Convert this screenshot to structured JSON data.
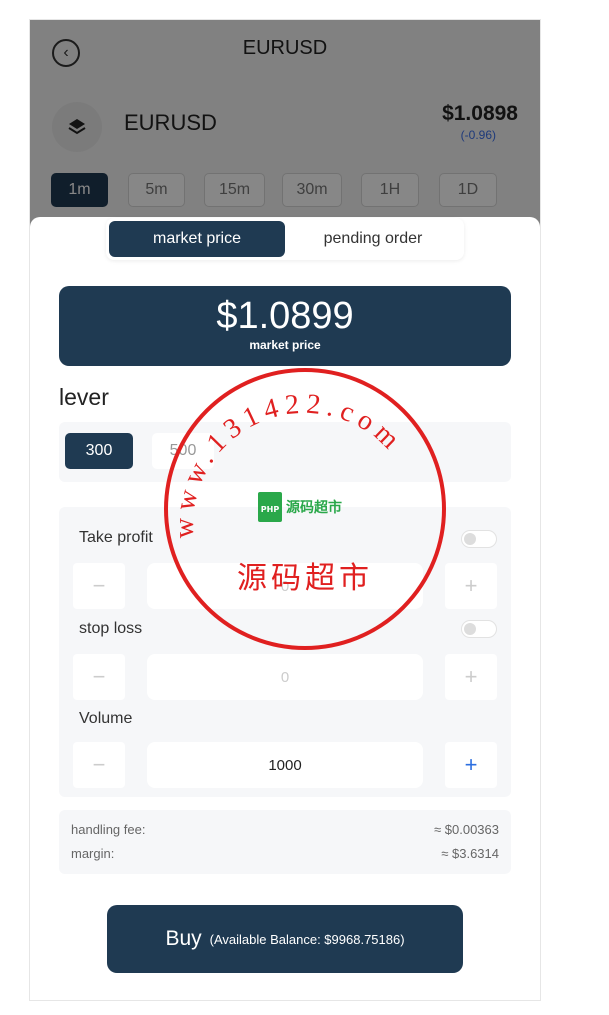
{
  "header": {
    "title": "EURUSD"
  },
  "symbol": {
    "name": "EURUSD",
    "price": "$1.0898",
    "change": "(-0.96)"
  },
  "timeframes": [
    "1m",
    "5m",
    "15m",
    "30m",
    "1H",
    "1D"
  ],
  "order_tabs": {
    "market": "market price",
    "pending": "pending order"
  },
  "price_display": {
    "value": "$1.0899",
    "caption": "market price"
  },
  "lever": {
    "title": "lever",
    "options": [
      "300",
      "500"
    ]
  },
  "take_profit": {
    "label": "Take profit",
    "value": "0"
  },
  "stop_loss": {
    "label": "stop loss",
    "value": "0"
  },
  "volume": {
    "label": "Volume",
    "value": "1000"
  },
  "fees": {
    "handling_label": "handling fee:",
    "handling_value": "≈ $0.00363",
    "margin_label": "margin:",
    "margin_value": "≈ $3.6314"
  },
  "buy": {
    "label": "Buy",
    "balance": "(Available Balance: $9968.75186)"
  },
  "watermark": {
    "url": "www.131422.com",
    "name": "源码超市",
    "logo_text": "PHP",
    "logo_title": "源码超市"
  },
  "colors": {
    "primary": "#1f3a52",
    "accent_blue": "#2c6fe0",
    "stamp_red": "#e02020"
  }
}
